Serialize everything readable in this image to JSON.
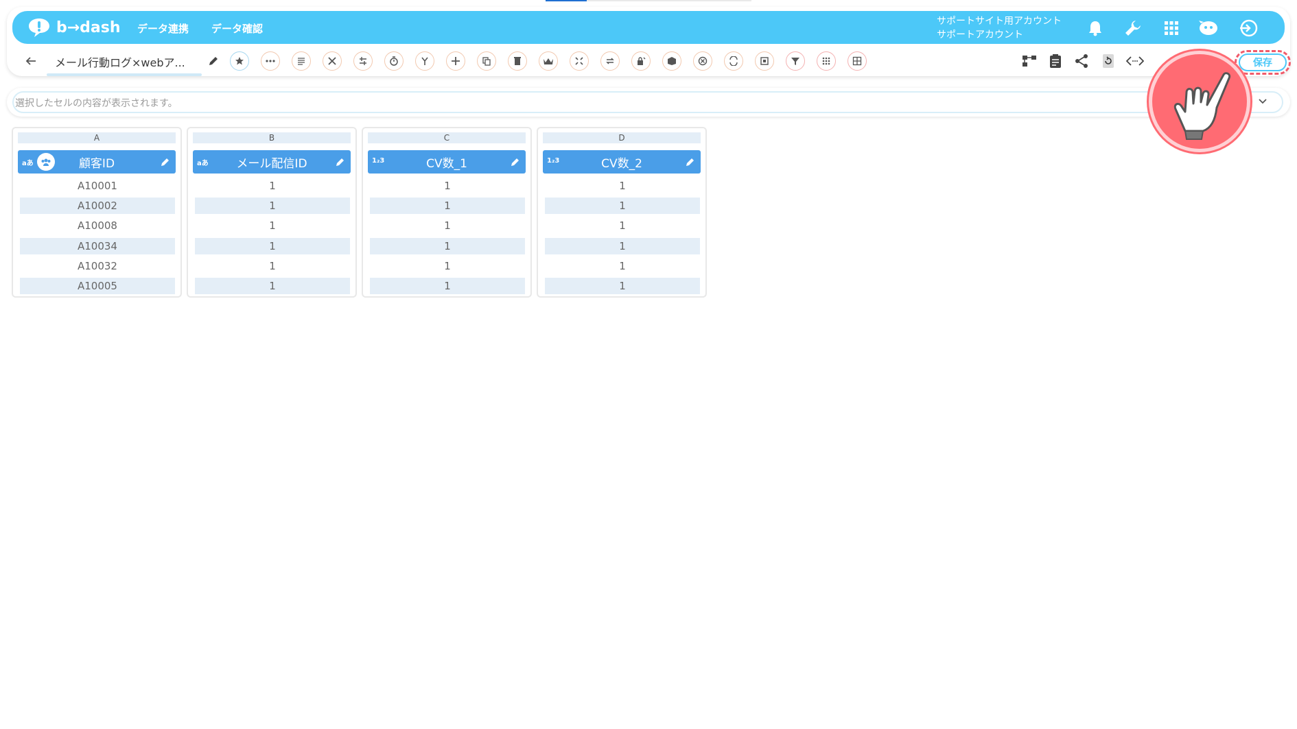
{
  "app": {
    "brand": "b→dash",
    "accent": "#4cc8f8",
    "table_header_color": "#4a9ee8"
  },
  "nav": {
    "items": [
      "データ連携",
      "データ確認"
    ]
  },
  "account": {
    "line1": "サポートサイト用アカウント",
    "line2": "サポートアカウント"
  },
  "toolbar": {
    "doc_title": "メール行動ログ×webア...",
    "save_label": "保存",
    "tool_icons": [
      "star-icon",
      "more-icon",
      "list-icon",
      "tools-icon",
      "transform-icon",
      "timer-icon",
      "branch-icon",
      "plus-icon",
      "copy-icon",
      "trash-icon",
      "crown-icon",
      "compress-icon",
      "repeat-icon",
      "lock-icon",
      "box-icon",
      "cancel-icon",
      "replace-icon",
      "frame-icon",
      "filter-icon",
      "grid-dots-icon",
      "table-icon"
    ]
  },
  "formula_bar": {
    "placeholder": "選択したセルの内容が表示されます。"
  },
  "columns": [
    {
      "letter": "A",
      "type": "aあ",
      "name": "顧客ID",
      "cells": [
        "A10001",
        "A10002",
        "A10008",
        "A10034",
        "A10032",
        "A10005"
      ]
    },
    {
      "letter": "B",
      "type": "aあ",
      "name": "メール配信ID",
      "cells": [
        "1",
        "1",
        "1",
        "1",
        "1",
        "1"
      ]
    },
    {
      "letter": "C",
      "type": "1₂3",
      "name": "CV数_1",
      "cells": [
        "1",
        "1",
        "1",
        "1",
        "1",
        "1"
      ]
    },
    {
      "letter": "D",
      "type": "1₂3",
      "name": "CV数_2",
      "cells": [
        "1",
        "1",
        "1",
        "1",
        "1",
        "1"
      ]
    }
  ]
}
